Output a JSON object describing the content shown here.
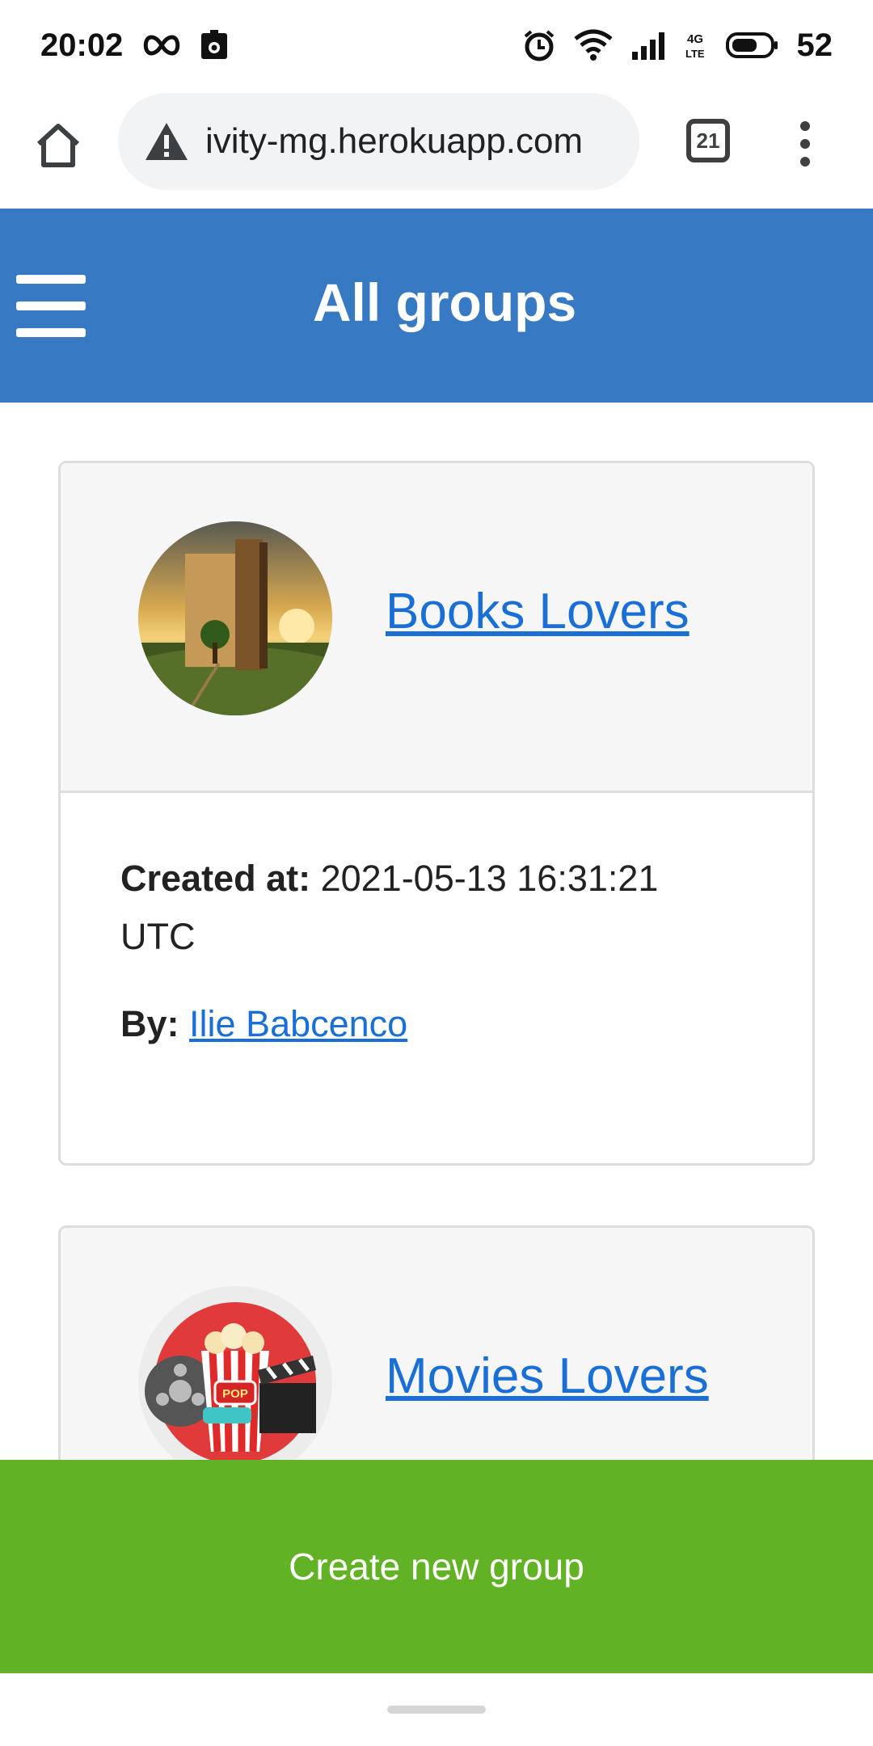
{
  "status_bar": {
    "time": "20:02",
    "battery": "52",
    "network": "4G LTE"
  },
  "browser": {
    "url": "ivity-mg.herokuapp.com",
    "tab_count": "21",
    "icons": [
      "home-icon",
      "warning-icon",
      "tabs-icon",
      "more-vert-icon"
    ]
  },
  "header": {
    "title": "All groups",
    "menu_icon": "hamburger-icon"
  },
  "groups": [
    {
      "name": "Books Lovers",
      "created_label": "Created at:",
      "created_value": "2021-05-13 16:31:21 UTC",
      "by_label": "By:",
      "author": "Ilie Babcenco"
    },
    {
      "name": "Movies Lovers"
    }
  ],
  "cta": {
    "label": "Create new group"
  },
  "colors": {
    "header": "#3879c4",
    "cta": "#61b224",
    "link": "#1a6fd6"
  }
}
